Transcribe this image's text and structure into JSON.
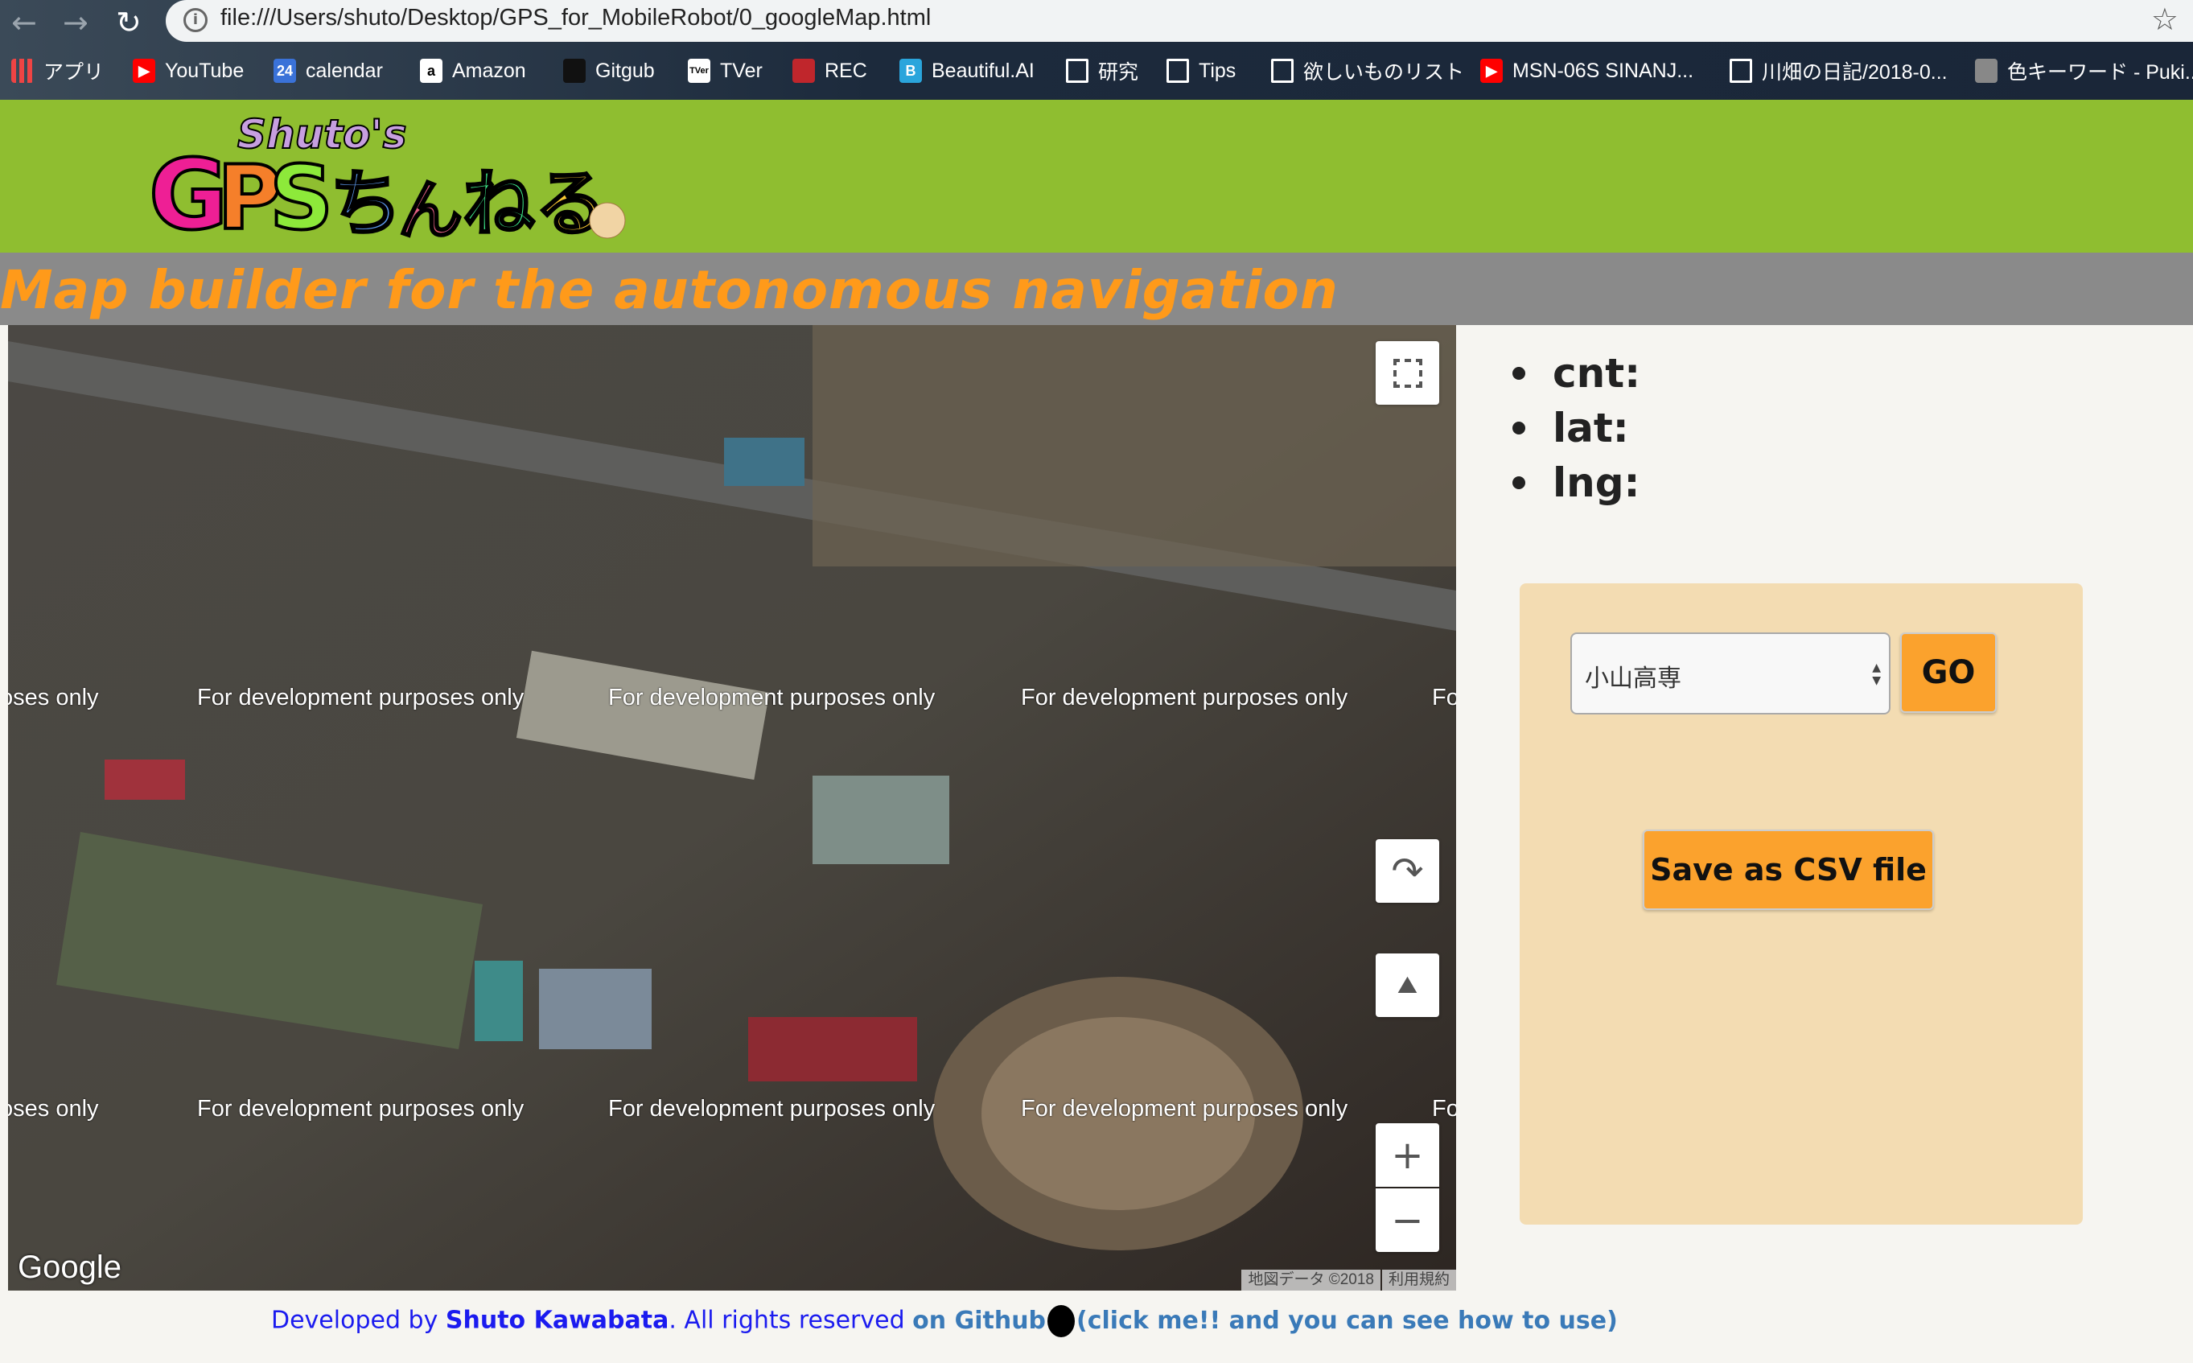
{
  "browser": {
    "url": "file:///Users/shuto/Desktop/GPS_for_MobileRobot/0_googleMap.html",
    "bookmarks": [
      {
        "label": "アプリ",
        "icon": "apps-grid-icon"
      },
      {
        "label": "YouTube",
        "icon": "youtube-icon",
        "color": "#ff0000"
      },
      {
        "label": "calendar",
        "icon": "calendar-icon",
        "badge": "24",
        "color": "#3a72d8"
      },
      {
        "label": "Amazon",
        "icon": "amazon-icon",
        "badge": "a",
        "color": "#ffffff"
      },
      {
        "label": "Gitgub",
        "icon": "github-icon",
        "color": "#111111"
      },
      {
        "label": "TVer",
        "icon": "tver-icon",
        "badge": "TVer",
        "color": "#ffffff"
      },
      {
        "label": "REC",
        "icon": "rec-icon",
        "color": "#c0262c"
      },
      {
        "label": "Beautiful.AI",
        "icon": "beautiful-ai-icon",
        "badge": "B",
        "color": "#2aa5dc"
      },
      {
        "label": "研究",
        "icon": "folder-icon"
      },
      {
        "label": "Tips",
        "icon": "folder-icon"
      },
      {
        "label": "欲しいものリスト",
        "icon": "folder-icon"
      },
      {
        "label": "MSN-06S SINANJ...",
        "icon": "youtube-icon",
        "color": "#ff0000"
      },
      {
        "label": "川畑の日記/2018-0...",
        "icon": "document-icon"
      },
      {
        "label": "色キーワード - Puki...",
        "icon": "pukiwiki-icon"
      }
    ]
  },
  "header": {
    "logo_text": "Shuto's GPSちゃんねる",
    "title": "Map builder for the autonomous navigation"
  },
  "map": {
    "watermark": "For development purposes only",
    "watermark_partial_left": "oses only",
    "watermark_partial_right": "Fo",
    "google": "Google",
    "map_data": "地図データ ©2018",
    "terms": "利用規約",
    "zoom_in": "+",
    "zoom_out": "−"
  },
  "info": {
    "cnt": "cnt:",
    "lat": "lat:",
    "lng": "lng:"
  },
  "panel": {
    "selected_place": "小山高専",
    "go": "GO",
    "save": "Save as CSV file"
  },
  "footer": {
    "developed_by": "Developed by ",
    "author": "Shuto Kawabata",
    "rights": ". All rights reserved ",
    "github": "on Github",
    "click": "(click me!! and you can see how to use)"
  }
}
